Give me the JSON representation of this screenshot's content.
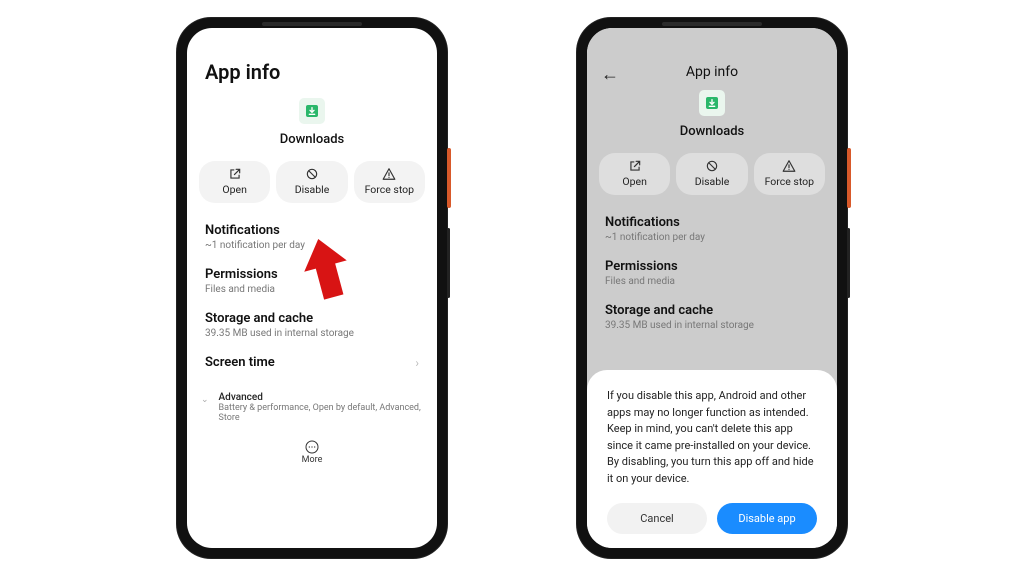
{
  "phone1": {
    "title": "App info",
    "app_name": "Downloads",
    "actions": {
      "open": "Open",
      "disable": "Disable",
      "force_stop": "Force stop"
    },
    "items": {
      "notifications": {
        "title": "Notifications",
        "sub": "~1 notification per day"
      },
      "permissions": {
        "title": "Permissions",
        "sub": "Files and media"
      },
      "storage": {
        "title": "Storage and cache",
        "sub": "39.35 MB used in internal storage"
      },
      "screen_time": {
        "title": "Screen time"
      }
    },
    "advanced": {
      "title": "Advanced",
      "sub": "Battery & performance, Open by default, Advanced, Store"
    },
    "more": "More"
  },
  "phone2": {
    "header": "App info",
    "app_name": "Downloads",
    "actions": {
      "open": "Open",
      "disable": "Disable",
      "force_stop": "Force stop"
    },
    "items": {
      "notifications": {
        "title": "Notifications",
        "sub": "~1 notification per day"
      },
      "permissions": {
        "title": "Permissions",
        "sub": "Files and media"
      },
      "storage": {
        "title": "Storage and cache",
        "sub": "39.35 MB used in internal storage"
      }
    },
    "dialog": {
      "body": "If you disable this app, Android and other apps may no longer function as intended. Keep in mind, you can't delete this app since it came pre-installed on your device. By disabling, you turn this app off and hide it on your device.",
      "cancel": "Cancel",
      "confirm": "Disable app"
    }
  }
}
